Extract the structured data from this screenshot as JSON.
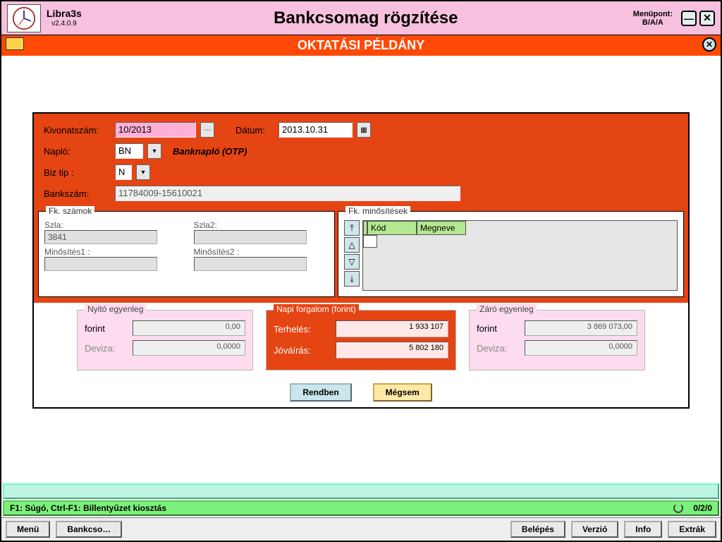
{
  "header": {
    "app_name": "Libra3s",
    "version": "v2.4.0.9",
    "page_title": "Bankcsomag rögzítése",
    "menu_label": "Menüpont:",
    "menu_code": "B/A/A"
  },
  "banner": {
    "text": "OKTATÁSI PÉLDÁNY"
  },
  "form": {
    "kivonat_lbl": "Kivonatszám:",
    "kivonat_val": "10/2013",
    "datum_lbl": "Dátum:",
    "datum_val": "2013.10.31",
    "naplo_lbl": "Napló:",
    "naplo_val": "BN",
    "naplo_desc": "Banknapló (OTP)",
    "biztip_lbl": "Biz tip :",
    "biztip_val": "N",
    "bankszam_lbl": "Bankszám:",
    "bankszam_val": "11784009-15610021"
  },
  "fk_szamok": {
    "legend": "Fk. számok",
    "szla_lbl": "Szla:",
    "szla_val": "3841",
    "szla2_lbl": "Szla2:",
    "szla2_val": "",
    "min1_lbl": "Minősítés1 :",
    "min1_val": "",
    "min2_lbl": "Minősítés2 :",
    "min2_val": ""
  },
  "fk_min": {
    "legend": "Fk. minősítések",
    "col_kod": "Kód",
    "col_meg": "Megneve"
  },
  "nyito": {
    "legend": "Nyitó egyenleg",
    "forint_lbl": "forint",
    "forint_val": "0,00",
    "deviza_lbl": "Deviza:",
    "deviza_val": "0,0000"
  },
  "napi": {
    "legend": "Napi forgalom (forint)",
    "terheles_lbl": "Terhelés:",
    "terheles_val": "1 933 107",
    "jovairas_lbl": "Jóváírás:",
    "jovairas_val": "5 802 180"
  },
  "zaro": {
    "legend": "Záró egyenleg",
    "forint_lbl": "forint",
    "forint_val": "3 869 073,00",
    "deviza_lbl": "Deviza:",
    "deviza_val": "0,0000"
  },
  "buttons": {
    "ok": "Rendben",
    "cancel": "Mégsem"
  },
  "status": {
    "help_text": "F1: Súgó, Ctrl-F1: Billentyűzet kiosztás",
    "counter": "0/2/0"
  },
  "bottom": {
    "menu": "Menü",
    "bankcso": "Bankcso…",
    "belepes": "Belépés",
    "verzio": "Verzió",
    "info": "Info",
    "extrak": "Extrák"
  },
  "glyphs": {
    "minimize": "—",
    "close_x": "✕",
    "ellipsis": "⋯",
    "dropdown": "▾",
    "cal": "▦",
    "top": "⤒",
    "up": "△",
    "down": "▽",
    "bottom": "⤓"
  }
}
